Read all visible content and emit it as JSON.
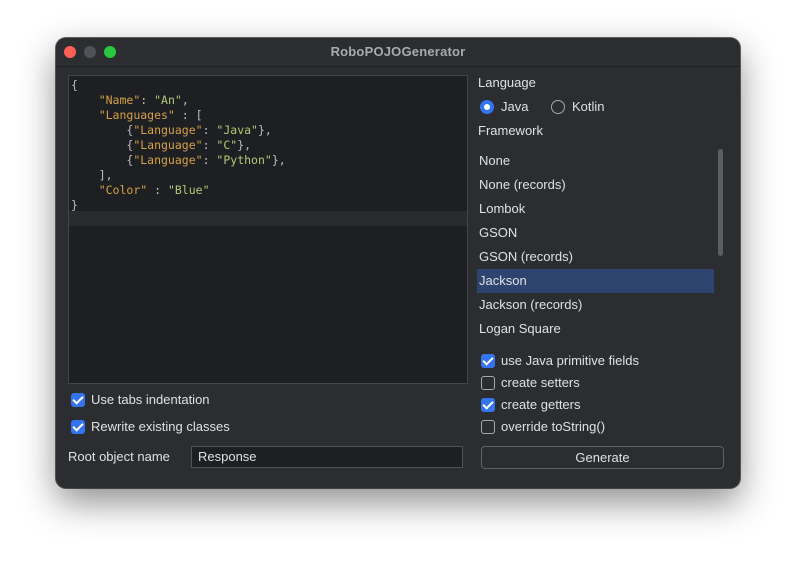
{
  "window": {
    "title": "RoboPOJOGenerator"
  },
  "editor": {
    "lines": [
      [
        {
          "t": "{",
          "c": "p"
        }
      ],
      [
        {
          "t": "    ",
          "c": "p"
        },
        {
          "t": "\"Name\"",
          "c": "k"
        },
        {
          "t": ": ",
          "c": "p"
        },
        {
          "t": "\"An\"",
          "c": "s"
        },
        {
          "t": ",",
          "c": "p"
        }
      ],
      [
        {
          "t": "    ",
          "c": "p"
        },
        {
          "t": "\"Languages\"",
          "c": "k"
        },
        {
          "t": " : [",
          "c": "p"
        }
      ],
      [
        {
          "t": "        {",
          "c": "p"
        },
        {
          "t": "\"Language\"",
          "c": "k"
        },
        {
          "t": ": ",
          "c": "p"
        },
        {
          "t": "\"Java\"",
          "c": "s"
        },
        {
          "t": "},",
          "c": "p"
        }
      ],
      [
        {
          "t": "        {",
          "c": "p"
        },
        {
          "t": "\"Language\"",
          "c": "k"
        },
        {
          "t": ": ",
          "c": "p"
        },
        {
          "t": "\"C\"",
          "c": "s"
        },
        {
          "t": "},",
          "c": "p"
        }
      ],
      [
        {
          "t": "        {",
          "c": "p"
        },
        {
          "t": "\"Language\"",
          "c": "k"
        },
        {
          "t": ": ",
          "c": "p"
        },
        {
          "t": "\"Python\"",
          "c": "s"
        },
        {
          "t": "},",
          "c": "p"
        }
      ],
      [
        {
          "t": "    ],",
          "c": "p"
        }
      ],
      [
        {
          "t": "    ",
          "c": "p"
        },
        {
          "t": "\"Color\"",
          "c": "k"
        },
        {
          "t": " : ",
          "c": "p"
        },
        {
          "t": "\"Blue\"",
          "c": "s"
        }
      ],
      [
        {
          "t": "}",
          "c": "p"
        }
      ]
    ]
  },
  "options_left": {
    "use_tabs": {
      "label": "Use tabs indentation",
      "checked": true
    },
    "rewrite": {
      "label": "Rewrite existing classes",
      "checked": true
    }
  },
  "root_object": {
    "label": "Root object name",
    "value": "Response"
  },
  "language": {
    "label": "Language",
    "options": [
      {
        "label": "Java",
        "selected": true
      },
      {
        "label": "Kotlin",
        "selected": false
      }
    ]
  },
  "framework": {
    "label": "Framework",
    "items": [
      "None",
      "None (records)",
      "Lombok",
      "GSON",
      "GSON (records)",
      "Jackson",
      "Jackson (records)",
      "Logan Square"
    ],
    "selected": "Jackson"
  },
  "options_right": {
    "primitive": {
      "label": "use Java primitive fields",
      "checked": true
    },
    "setters": {
      "label": "create setters",
      "checked": false
    },
    "getters": {
      "label": "create getters",
      "checked": true
    },
    "tostring": {
      "label": "override toString()",
      "checked": false
    }
  },
  "generate_button": {
    "label": "Generate"
  },
  "colors": {
    "accent": "#3574f0",
    "selection": "#2e436e",
    "json_key": "#d5a14b",
    "json_string": "#b3c97a"
  }
}
